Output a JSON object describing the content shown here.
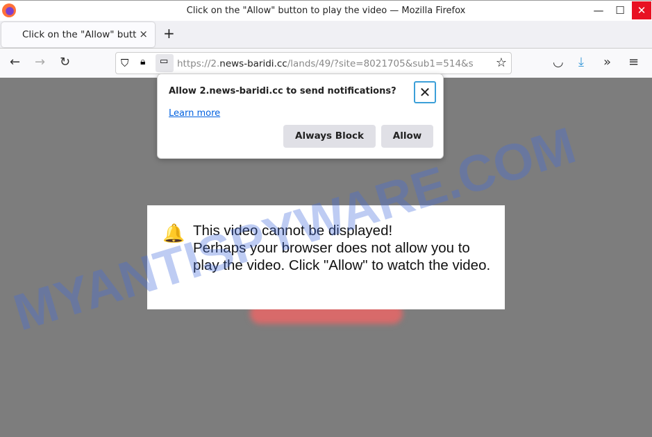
{
  "window": {
    "title": "Click on the \"Allow\" button to play the video — Mozilla Firefox",
    "minimize": "—",
    "maximize": "☐",
    "close": "✕"
  },
  "tab": {
    "label": "Click on the \"Allow\" button to play the video",
    "close": "×",
    "new_tab": "+"
  },
  "nav": {
    "back": "←",
    "forward": "→",
    "reload": "↻",
    "url_prefix": "https://2.",
    "url_domain": "news-baridi.cc",
    "url_rest": "/lands/49/?site=8021705&sub1=514&s",
    "bookmark": "☆",
    "pocket": "◡",
    "download": "⤓",
    "overflow": "»",
    "menu": "≡"
  },
  "popup": {
    "question": "Allow 2.news-baridi.cc to send notifications?",
    "learn_more": "Learn more",
    "always_block": "Always Block",
    "allow": "Allow",
    "close": "✕"
  },
  "message": {
    "bell": "🔔",
    "line1": "This video cannot be displayed!",
    "line2": "Perhaps your browser does not allow you to play the video. Click \"Allow\" to watch the video."
  },
  "watermark": "MYANTISPYWARE.COM",
  "colors": {
    "close_red": "#e81123",
    "link": "#0060df",
    "bell": "#3a6fd8"
  }
}
